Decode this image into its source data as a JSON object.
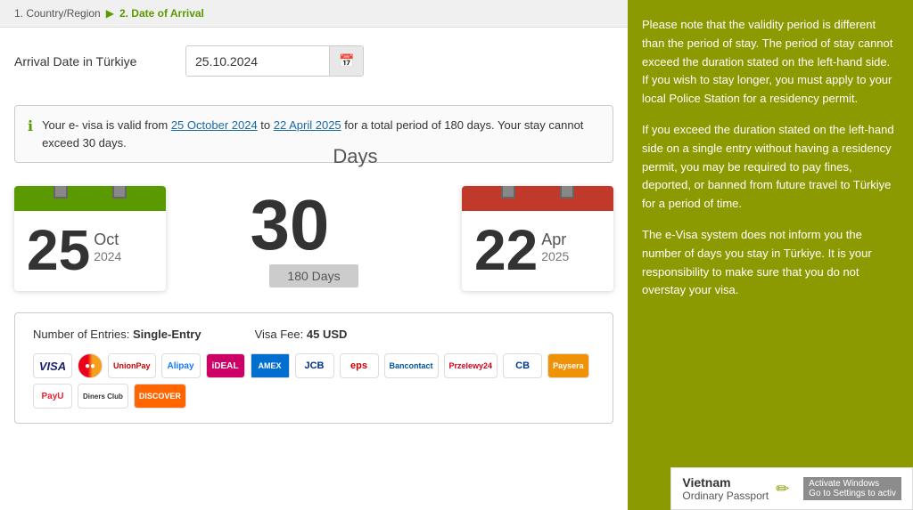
{
  "breadcrumb": {
    "step1": "1. Country/Region",
    "arrow": "▶",
    "step2": "2. Date of Arrival"
  },
  "arrival": {
    "label": "Arrival Date in Türkiye",
    "date_value": "25.10.2024",
    "calendar_icon": "📅"
  },
  "info_box": {
    "icon": "ℹ",
    "text_prefix": "Your e- visa is valid from ",
    "date_from": "25 October 2024",
    "text_mid": " to ",
    "date_to": "22 April 2025",
    "text_suffix": " for a total period of 180 days. Your stay cannot exceed 30 days."
  },
  "start_calendar": {
    "day": "25",
    "month": "Oct",
    "year": "2024",
    "color": "green"
  },
  "days_counter": {
    "number": "30",
    "label": "Days",
    "period_label": "180 Days"
  },
  "end_calendar": {
    "day": "22",
    "month": "Apr",
    "year": "2025",
    "color": "red"
  },
  "bottom_section": {
    "entries_label": "Number of Entries:",
    "entries_value": "Single-Entry",
    "fee_label": "Visa Fee:",
    "fee_value": "45 USD"
  },
  "right_panel": {
    "p1": "Please note that the validity period is different than the period of stay. The period of stay cannot exceed the duration stated on the left-hand side. If you wish to stay longer, you must apply to your local Police Station for a residency permit.",
    "p2": "If you exceed the duration stated on the left-hand side on a single entry without having a residency permit, you may be required to pay fines, deported, or banned from future travel to Türkiye for a period of time.",
    "p3": "The e-Visa system does not inform you the number of days you stay in Türkiye. It is your responsibility to make sure that you do not overstay your visa."
  },
  "country_badge": {
    "country": "Vietnam",
    "passport": "Ordinary Passport",
    "edit_icon": "✏"
  },
  "windows_activate": "Activate Windows\nGo to Settings to activ"
}
